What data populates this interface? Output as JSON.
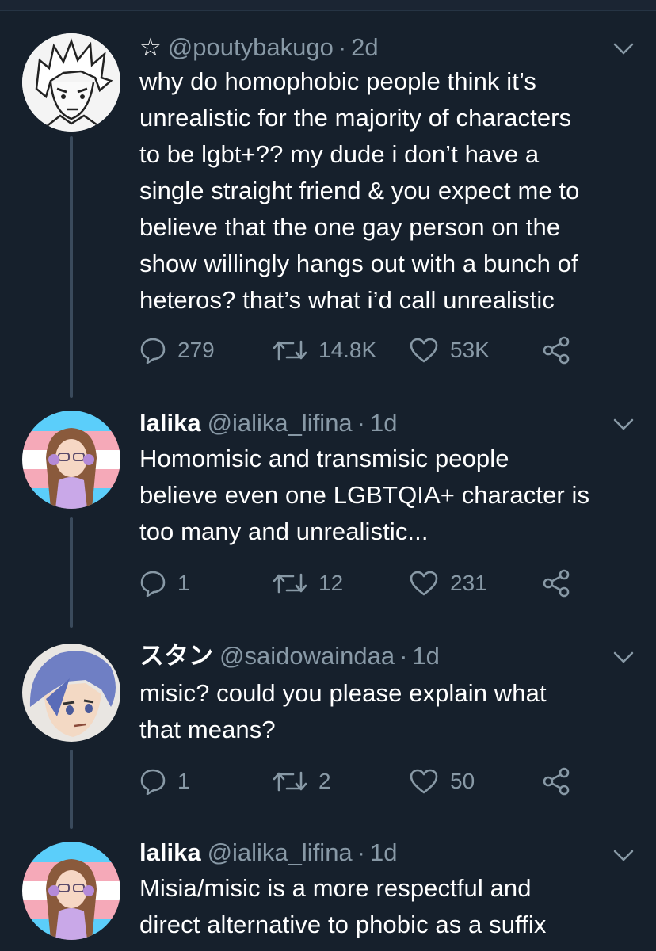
{
  "colors": {
    "background": "#16202c",
    "text": "#ffffff",
    "muted": "#8899a6",
    "thread_line": "#3a4a5c"
  },
  "tweets": [
    {
      "star": "☆",
      "name": "",
      "handle": "@poutybakugo",
      "time": "2d",
      "avatar_icon": "avatar-manga-boy-icon",
      "text_lines": [
        "why do homophobic people think it’s",
        "unrealistic for the majority of characters",
        "to be lgbt+?? my dude i don’t have a",
        "single straight friend & you expect me to",
        "believe that the one gay person on the",
        "show willingly hangs out with a bunch of",
        "heteros? that’s what i’d call unrealistic"
      ],
      "replies": "279",
      "retweets": "14.8K",
      "likes": "53K"
    },
    {
      "star": "",
      "name": "lalika",
      "handle": "@ialika_lifina",
      "time": "1d",
      "avatar_icon": "avatar-trans-flag-girl-icon",
      "text_lines": [
        "Homomisic and transmisic people",
        "believe even one LGBTQIA+ character is",
        "too many and unrealistic..."
      ],
      "replies": "1",
      "retweets": "12",
      "likes": "231"
    },
    {
      "star": "",
      "name": "スタン",
      "handle": "@saidowaindaa",
      "time": "1d",
      "avatar_icon": "avatar-blue-hair-boy-icon",
      "text_lines": [
        "misic? could you please explain what",
        "that means?"
      ],
      "replies": "1",
      "retweets": "2",
      "likes": "50"
    },
    {
      "star": "",
      "name": "lalika",
      "handle": "@ialika_lifina",
      "time": "1d",
      "avatar_icon": "avatar-trans-flag-girl-icon",
      "text_lines": [
        "Misia/misic is a more respectful and",
        "direct alternative to phobic as a suffix"
      ]
    }
  ]
}
